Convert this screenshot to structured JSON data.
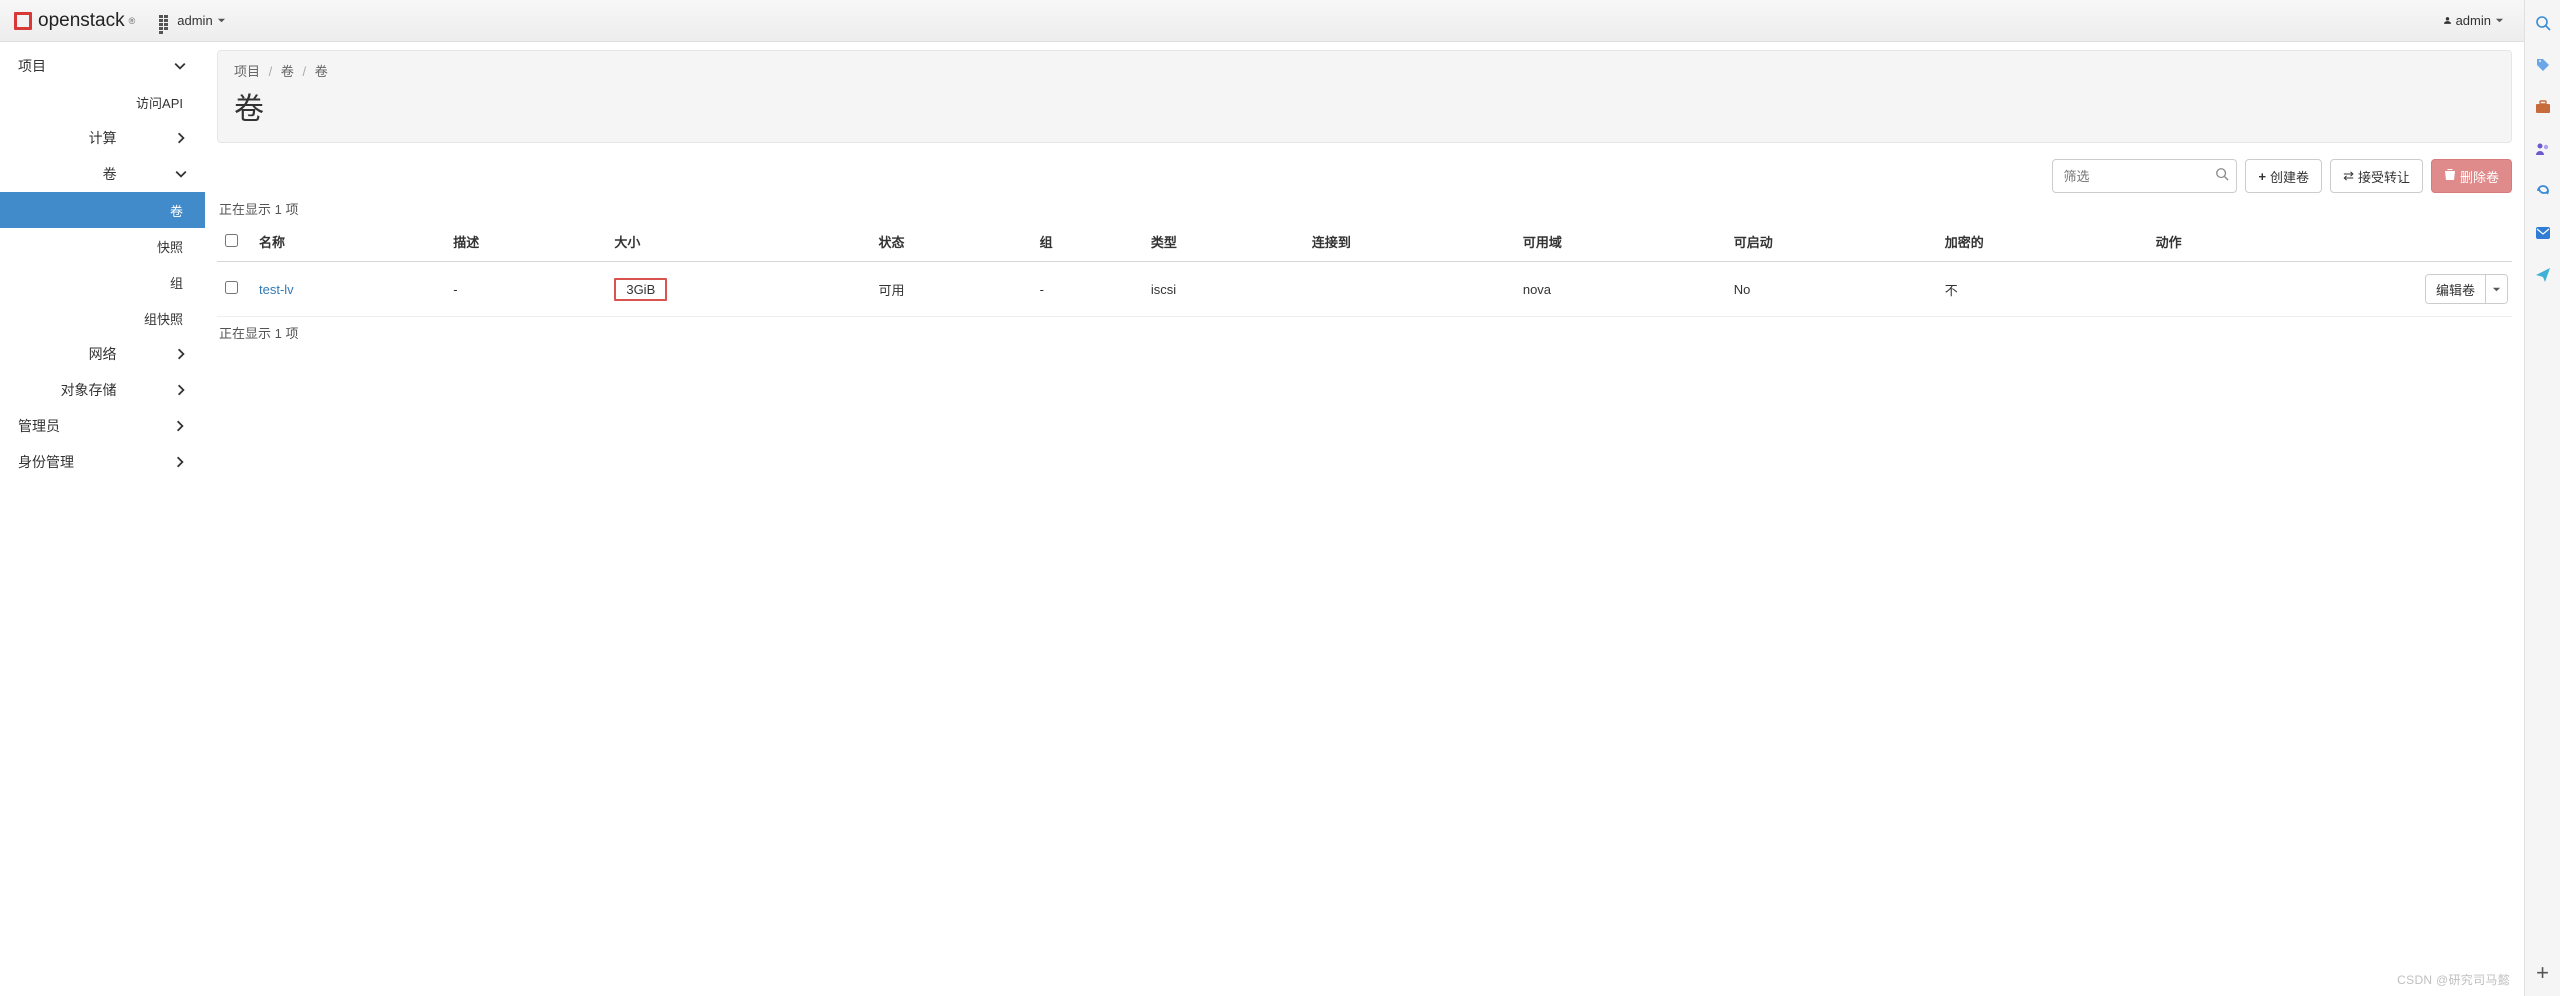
{
  "brand": {
    "name": "openstack",
    "tm": "®"
  },
  "project_selector": {
    "label": "admin"
  },
  "user_menu": {
    "label": "admin"
  },
  "sidebar": {
    "items": [
      {
        "label": "项目",
        "kind": "lvl0",
        "expanded": true
      },
      {
        "label": "访问API",
        "kind": "leaf"
      },
      {
        "label": "计算",
        "kind": "lvl1",
        "expanded": false
      },
      {
        "label": "卷",
        "kind": "lvl1",
        "expanded": true
      },
      {
        "label": "卷",
        "kind": "leaf",
        "active": true
      },
      {
        "label": "快照",
        "kind": "leaf"
      },
      {
        "label": "组",
        "kind": "leaf"
      },
      {
        "label": "组快照",
        "kind": "leaf"
      },
      {
        "label": "网络",
        "kind": "lvl1",
        "expanded": false
      },
      {
        "label": "对象存储",
        "kind": "lvl1",
        "expanded": false
      },
      {
        "label": "管理员",
        "kind": "lvl0",
        "expanded": false
      },
      {
        "label": "身份管理",
        "kind": "lvl0",
        "expanded": false
      }
    ]
  },
  "breadcrumbs": {
    "0": "项目",
    "1": "卷",
    "2": "卷",
    "sep": "/"
  },
  "page_title": "卷",
  "toolbar": {
    "filter_placeholder": "筛选",
    "create_label": "创建卷",
    "accept_label": "接受转让",
    "delete_label": "删除卷"
  },
  "count_text_top": "正在显示 1 项",
  "count_text_bottom": "正在显示 1 项",
  "table": {
    "headers": {
      "name": "名称",
      "desc": "描述",
      "size": "大小",
      "status": "状态",
      "group": "组",
      "type": "类型",
      "attached": "连接到",
      "az": "可用域",
      "bootable": "可启动",
      "encrypted": "加密的",
      "actions": "动作"
    },
    "rows": [
      {
        "name": "test-lv",
        "desc": "-",
        "size": "3GiB",
        "status": "可用",
        "group": "-",
        "type": "iscsi",
        "attached": "",
        "az": "nova",
        "bootable": "No",
        "encrypted": "不",
        "action_label": "编辑卷"
      }
    ]
  },
  "watermark": "CSDN @研究司马懿"
}
